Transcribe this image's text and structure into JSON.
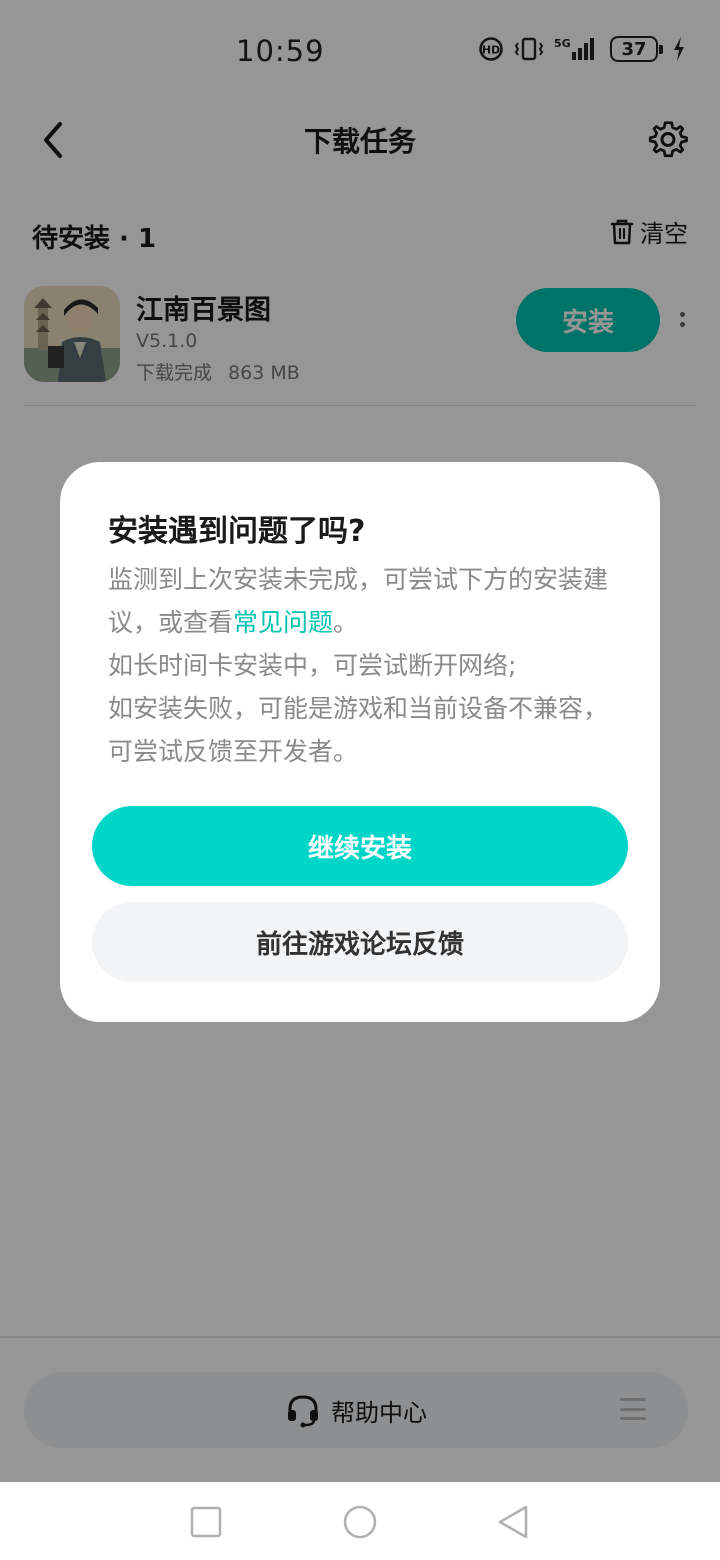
{
  "status_bar": {
    "time": "10:59",
    "battery": "37",
    "network": "5G",
    "icons": [
      "hd-call-icon",
      "vibrate-icon",
      "signal-icon",
      "battery-icon",
      "charging-icon"
    ]
  },
  "header": {
    "title": "下载任务",
    "back_icon": "chevron-left-icon",
    "settings_icon": "gear-icon"
  },
  "section": {
    "title": "待安装 · 1",
    "clear_label": "清空",
    "clear_icon": "trash-icon"
  },
  "app": {
    "name": "江南百景图",
    "version": "V5.1.0",
    "status": "下载完成",
    "size": "863 MB",
    "install_label": "安装"
  },
  "dialog": {
    "title": "安装遇到问题了吗?",
    "line1_prefix": "监测到上次安装未完成，可尝试下方的安装建议，或查看",
    "faq_link": "常见问题",
    "line1_suffix": "。",
    "line2": "如长时间卡安装中，可尝试断开网络;",
    "line3": "如安装失败，可能是游戏和当前设备不兼容，可尝试反馈至开发者。",
    "continue_label": "继续安装",
    "forum_label": "前往游戏论坛反馈"
  },
  "help": {
    "label": "帮助中心",
    "icon": "headset-icon"
  },
  "colors": {
    "accent": "#00d6c8",
    "install_button": "#00c4b2",
    "overlay": "rgba(0,0,0,0.41)"
  }
}
